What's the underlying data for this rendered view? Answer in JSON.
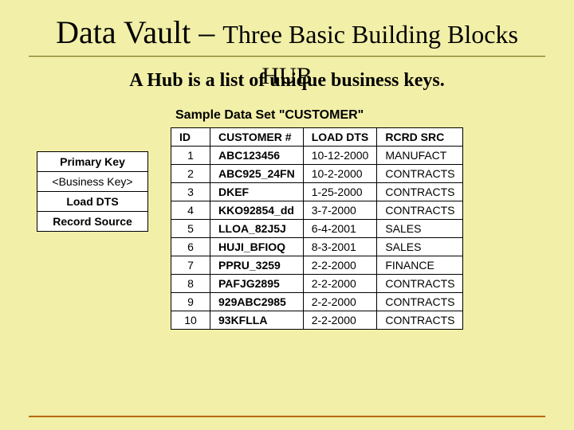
{
  "title_part1": "Data Vault",
  "title_dash": " – ",
  "title_part2": "Three Basic Building Blocks",
  "hub_label": "HUB",
  "hub_desc": "A Hub is a list of unique business keys.",
  "legend": {
    "r0": "Primary Key",
    "r1": "<Business Key>",
    "r2": "Load DTS",
    "r3": "Record Source"
  },
  "data_title": "Sample Data Set \"CUSTOMER\"",
  "headers": {
    "id": "ID",
    "customer": "CUSTOMER #",
    "load_dts": "LOAD DTS",
    "rcrd_src": "RCRD SRC"
  },
  "rows": [
    {
      "id": "1",
      "customer": "ABC123456",
      "load_dts": "10-12-2000",
      "rcrd_src": "MANUFACT"
    },
    {
      "id": "2",
      "customer": "ABC925_24FN",
      "load_dts": "10-2-2000",
      "rcrd_src": "CONTRACTS"
    },
    {
      "id": "3",
      "customer": "DKEF",
      "load_dts": "1-25-2000",
      "rcrd_src": "CONTRACTS"
    },
    {
      "id": "4",
      "customer": "KKO92854_dd",
      "load_dts": "3-7-2000",
      "rcrd_src": "CONTRACTS"
    },
    {
      "id": "5",
      "customer": "LLOA_82J5J",
      "load_dts": "6-4-2001",
      "rcrd_src": "SALES"
    },
    {
      "id": "6",
      "customer": "HUJI_BFIOQ",
      "load_dts": "8-3-2001",
      "rcrd_src": "SALES"
    },
    {
      "id": "7",
      "customer": "PPRU_3259",
      "load_dts": "2-2-2000",
      "rcrd_src": "FINANCE"
    },
    {
      "id": "8",
      "customer": "PAFJG2895",
      "load_dts": "2-2-2000",
      "rcrd_src": "CONTRACTS"
    },
    {
      "id": "9",
      "customer": "929ABC2985",
      "load_dts": "2-2-2000",
      "rcrd_src": "CONTRACTS"
    },
    {
      "id": "10",
      "customer": "93KFLLA",
      "load_dts": "2-2-2000",
      "rcrd_src": "CONTRACTS"
    }
  ]
}
